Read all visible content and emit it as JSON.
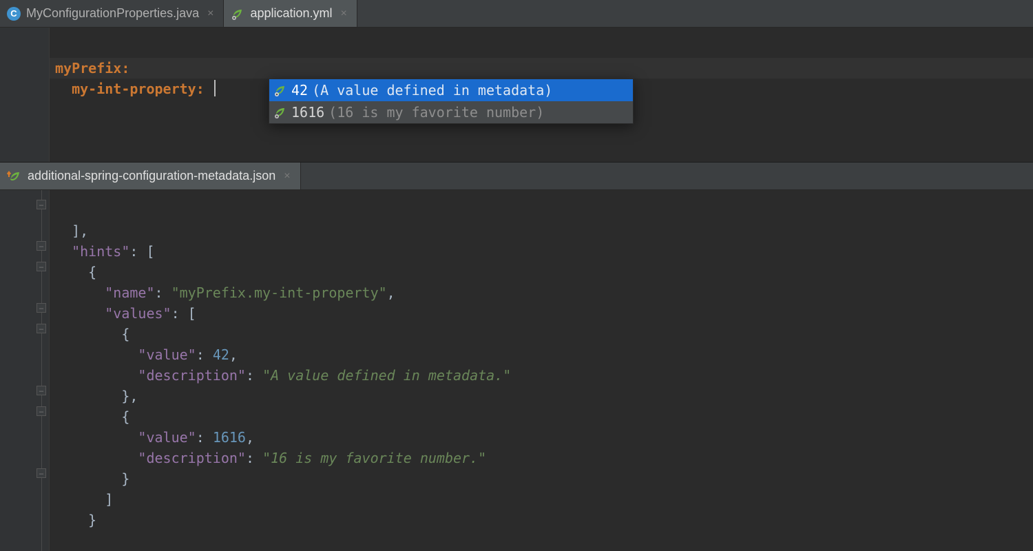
{
  "top": {
    "tabs": [
      {
        "label": "MyConfigurationProperties.java",
        "active": false,
        "icon": "java"
      },
      {
        "label": "application.yml",
        "active": true,
        "icon": "spring"
      }
    ],
    "yaml": {
      "line1_key": "myPrefix:",
      "line2_key": "my-int-property:"
    },
    "completion": [
      {
        "value": "42",
        "hint": "(A value defined in metadata)",
        "selected": true
      },
      {
        "value": "1616",
        "hint": "(16 is my favorite number)",
        "selected": false
      }
    ]
  },
  "bottom": {
    "tabs": [
      {
        "label": "additional-spring-configuration-metadata.json",
        "active": true,
        "icon": "spring-arrow"
      }
    ],
    "json": {
      "l1": "  ],",
      "l2k": "\"hints\"",
      "l2r": ": [",
      "l3": "    {",
      "l4k": "\"name\"",
      "l4v": "\"myPrefix.my-int-property\"",
      "l5k": "\"values\"",
      "l5r": ": [",
      "l6": "        {",
      "l7k": "\"value\"",
      "l7v": "42",
      "l8k": "\"description\"",
      "l8v": "\"A value defined in metadata.\"",
      "l9": "        },",
      "l10": "        {",
      "l11k": "\"value\"",
      "l11v": "1616",
      "l12k": "\"description\"",
      "l12v": "\"16 is my favorite number.\"",
      "l13": "        }",
      "l14": "      ]",
      "l15": "    }"
    }
  }
}
